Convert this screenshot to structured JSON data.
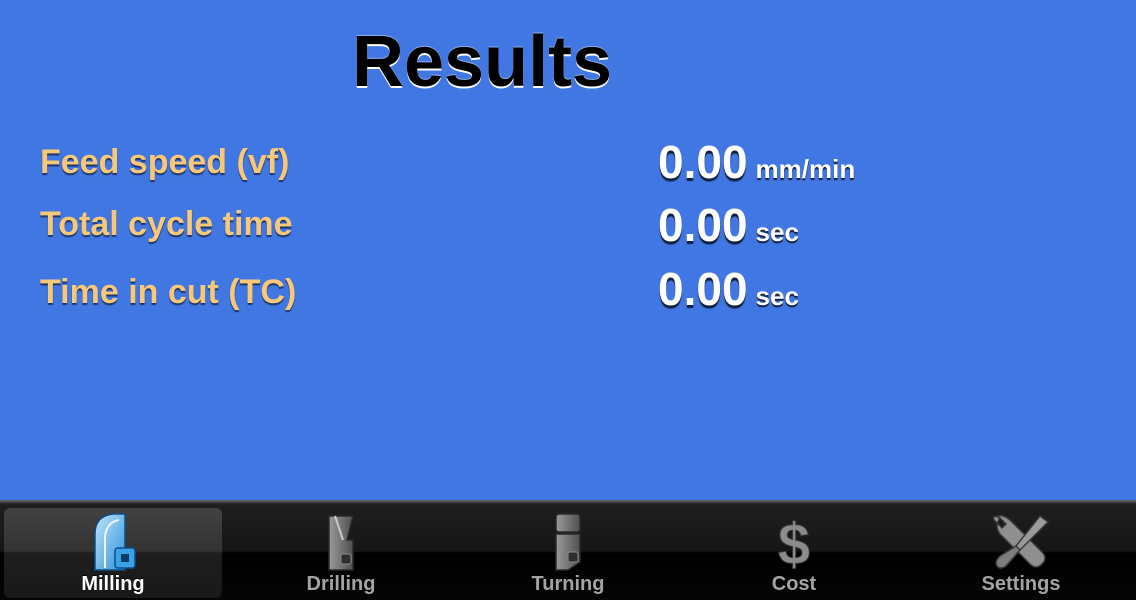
{
  "page": {
    "title": "Results",
    "background_color": "#4177e2",
    "label_color": "#f7c77a"
  },
  "results": [
    {
      "label": "Feed speed (vf)",
      "value": "0.00",
      "unit": "mm/min"
    },
    {
      "label": "Total cycle time",
      "value": "0.00",
      "unit": "sec"
    },
    {
      "label": "Time in cut (TC)",
      "value": "0.00",
      "unit": "sec"
    }
  ],
  "tabbar": {
    "selected": "Milling",
    "tabs": [
      {
        "label": "Milling",
        "icon": "milling-icon"
      },
      {
        "label": "Drilling",
        "icon": "drilling-icon"
      },
      {
        "label": "Turning",
        "icon": "turning-icon"
      },
      {
        "label": "Cost",
        "icon": "dollar-icon"
      },
      {
        "label": "Settings",
        "icon": "tools-icon"
      }
    ]
  }
}
